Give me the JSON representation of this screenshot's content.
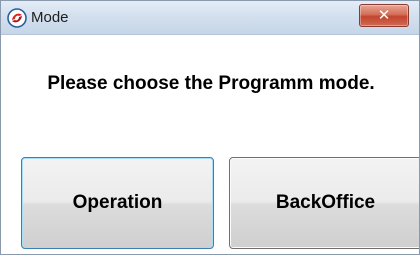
{
  "window": {
    "title": "Mode",
    "close_glyph": "✕",
    "icon": "app-logo-icon"
  },
  "dialog": {
    "message": "Please choose the Programm mode."
  },
  "buttons": {
    "operation_label": "Operation",
    "backoffice_label": "BackOffice"
  },
  "colors": {
    "close_button": "#c2452e",
    "focus_border": "#3c7fb1",
    "app_icon_red": "#d9251c"
  }
}
